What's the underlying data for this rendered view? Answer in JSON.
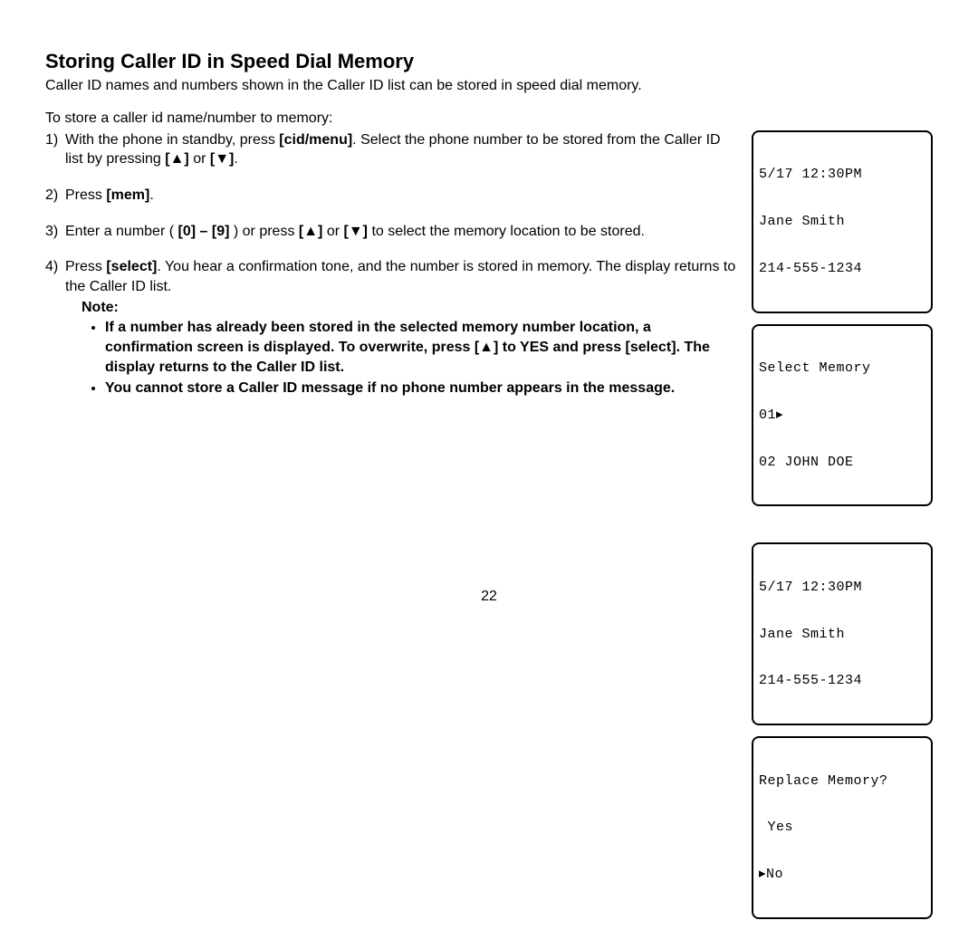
{
  "heading": "Storing Caller ID in Speed Dial Memory",
  "intro": "Caller ID names and numbers shown in the Caller ID list can be stored in speed dial memory.",
  "subintro": "To store a caller id name/number to memory:",
  "steps": {
    "s1": {
      "num": "1)",
      "t1": "With the phone in standby, press ",
      "key1": "[cid/menu]",
      "t2": ". Select the phone number to be stored from the Caller ID list by pressing ",
      "up": "[▲]",
      "or": " or ",
      "down": "[▼]",
      "end": "."
    },
    "s2": {
      "num": "2)",
      "t1": "Press ",
      "key1": "[mem]",
      "end": "."
    },
    "s3": {
      "num": "3)",
      "t1": "Enter a number ( ",
      "k0": "[0]",
      "dash": " – ",
      "k9": "[9]",
      "t2": " ) or press ",
      "up": "[▲]",
      "or": " or ",
      "down": "[▼]",
      "t3": " to select the memory location to be stored."
    },
    "s4": {
      "num": "4)",
      "t1": "Press ",
      "key1": "[select]",
      "t2": ". You hear a confirmation tone, and the number is stored in memory. The display returns to the Caller ID list."
    }
  },
  "note_label": "Note:",
  "notes": {
    "n1a": "If a number has already been stored in the selected memory number location, a confirmation screen is displayed. To overwrite, press ",
    "n1up": "[▲]",
    "n1b": " to YES and press [select]. The display returns to the Caller ID list.",
    "n2": "You cannot store a Caller ID message if no phone number appears in the message."
  },
  "lcd1": {
    "l1": "5/17 12:30PM",
    "l2": "Jane Smith",
    "l3": "214-555-1234"
  },
  "lcd2": {
    "l1": "Select Memory",
    "l2": "01▸",
    "l3": "02 JOHN DOE"
  },
  "lcd3": {
    "l1": "5/17 12:30PM",
    "l2": "Jane Smith",
    "l3": "214-555-1234"
  },
  "lcd4": {
    "l1": "Replace Memory?",
    "l2": " Yes",
    "l3": "▸No"
  },
  "page_number": "22"
}
